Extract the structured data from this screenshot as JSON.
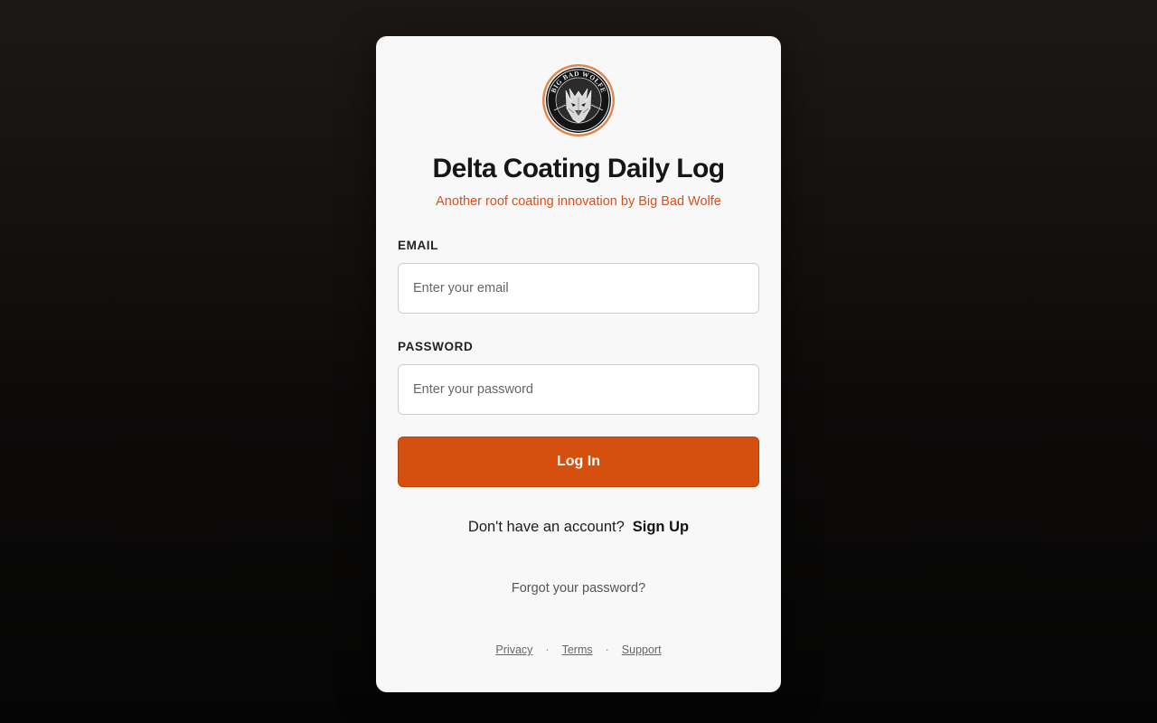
{
  "login": {
    "logo_text": "BIG BAD WOLFE",
    "title": "Delta Coating Daily Log",
    "subtitle": "Another roof coating innovation by Big Bad Wolfe",
    "email_label": "EMAIL",
    "email_placeholder": "Enter your email",
    "email_value": "",
    "password_label": "PASSWORD",
    "password_placeholder": "Enter your password",
    "password_value": "",
    "login_button": "Log In",
    "signup_prompt": "Don't have an account?",
    "signup_link": "Sign Up",
    "forgot_link": "Forgot your password?"
  },
  "footer": {
    "links": [
      "Privacy",
      "Terms",
      "Support"
    ],
    "separator": "·"
  },
  "colors": {
    "accent": "#d5500f",
    "subtitle": "#d8501d",
    "card": "#f8f8f8",
    "background": "#120f0d"
  }
}
